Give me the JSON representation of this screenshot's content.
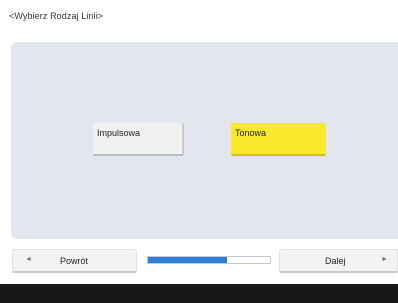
{
  "header": {
    "title": "<Wybierz Rodzaj Linii>"
  },
  "options": [
    {
      "label": "Impulsowa",
      "selected": false
    },
    {
      "label": "Tonowa",
      "selected": true
    }
  ],
  "footer": {
    "back_label": "Powrót",
    "next_label": "Dalej",
    "back_arrow": "◄",
    "next_arrow": "►",
    "progress": 0.65
  },
  "colors": {
    "selected": "#f8ea2a",
    "panel": "#e4e6ef",
    "progress": "#2f7fd6",
    "bottom_bar": "#181818"
  }
}
